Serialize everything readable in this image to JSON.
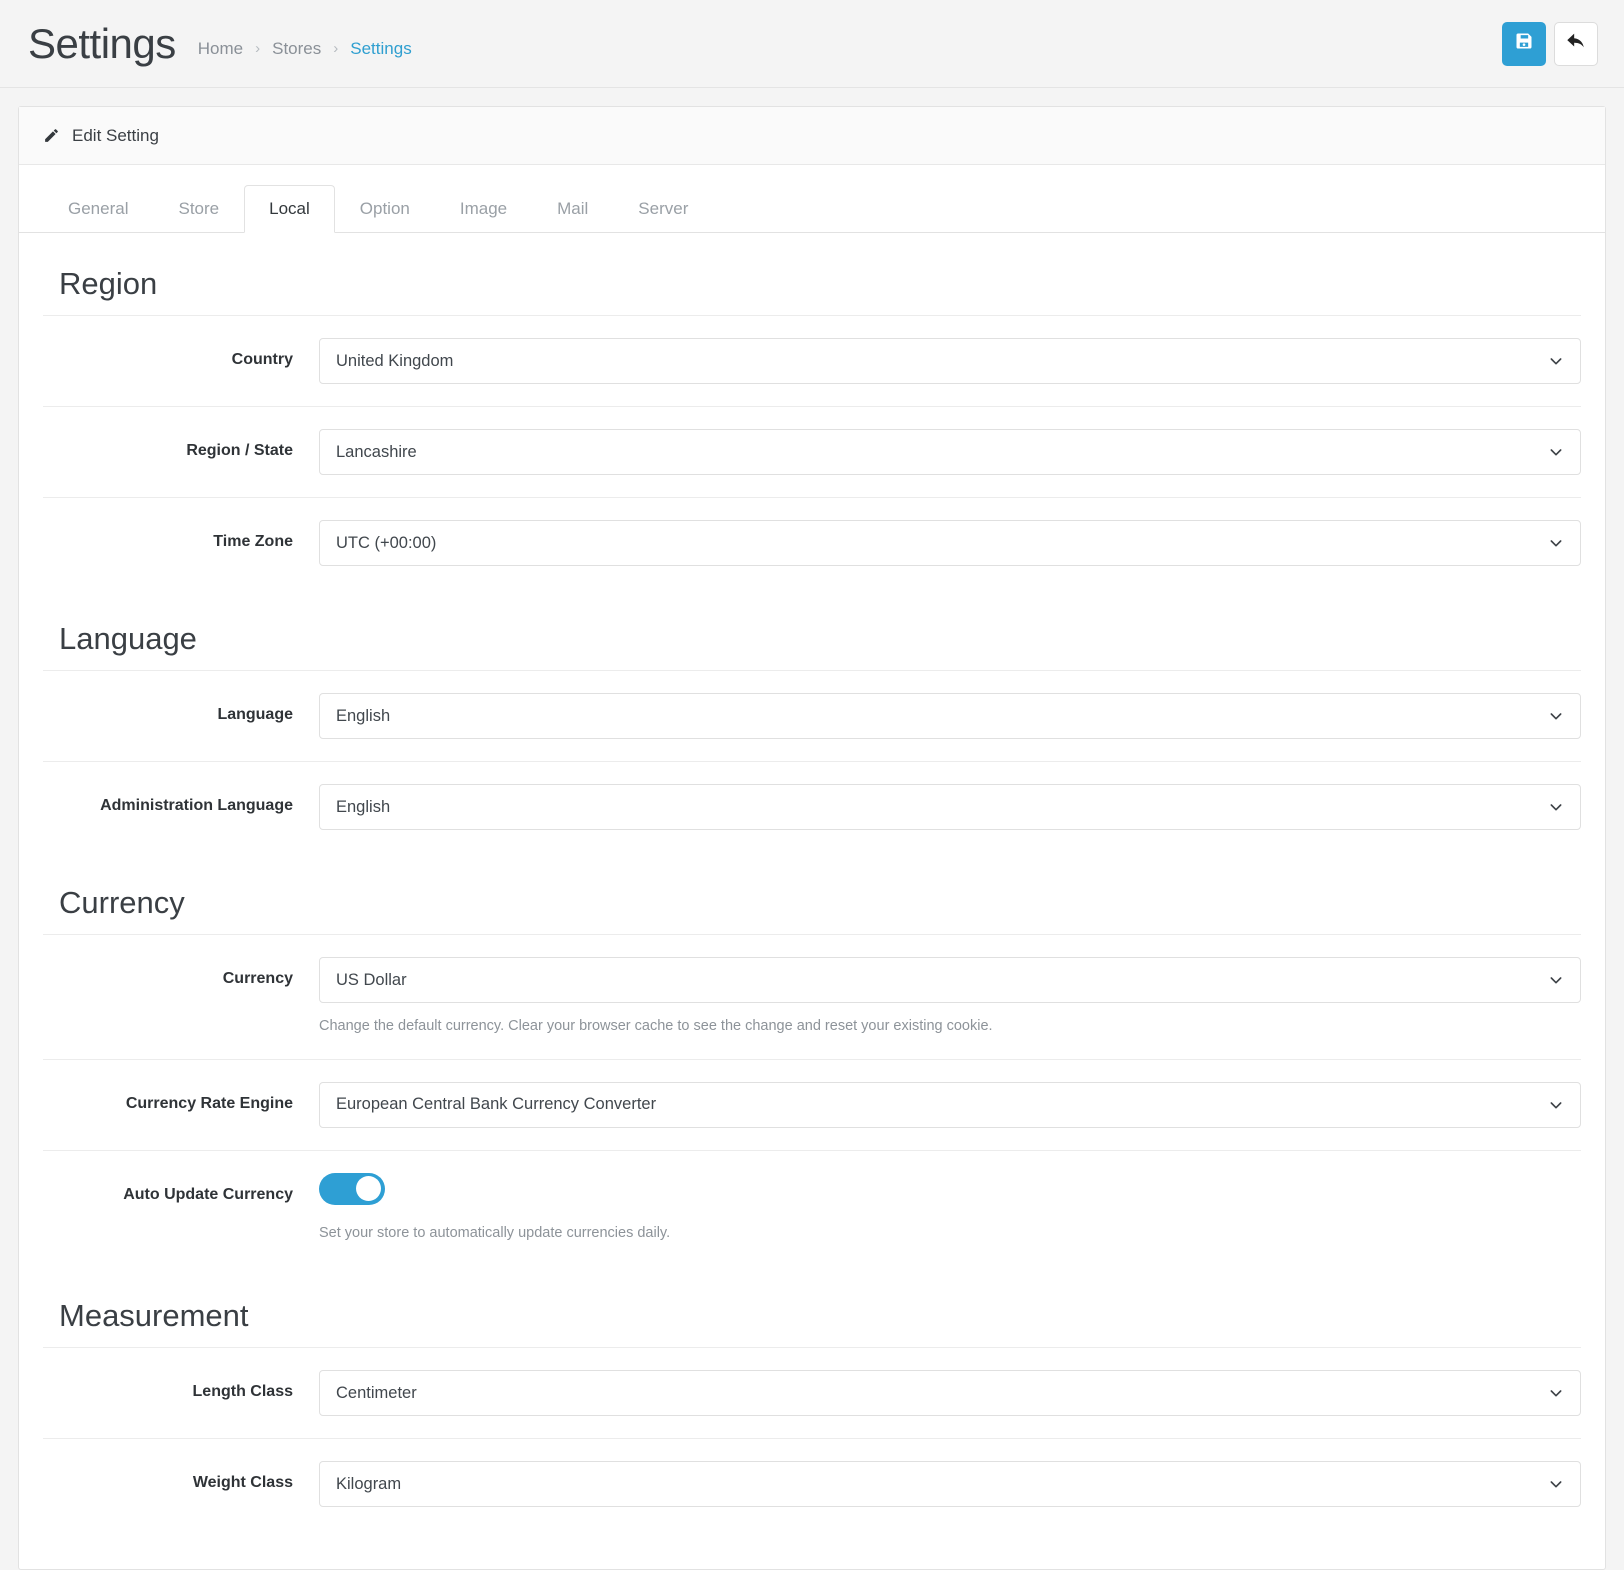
{
  "header": {
    "title": "Settings",
    "breadcrumb": [
      {
        "label": "Home",
        "active": false
      },
      {
        "label": "Stores",
        "active": false
      },
      {
        "label": "Settings",
        "active": true
      }
    ],
    "separator": "›",
    "actions": {
      "save": {
        "name": "save-icon",
        "title": "Save"
      },
      "back": {
        "name": "back-arrow-icon",
        "title": "Back"
      }
    },
    "accent_color": "#2e9fd4",
    "link_color": "#2f9fd0"
  },
  "card": {
    "header_icon": "pencil-icon",
    "header_title": "Edit Setting"
  },
  "tabs": [
    {
      "label": "General",
      "active": false
    },
    {
      "label": "Store",
      "active": false
    },
    {
      "label": "Local",
      "active": true
    },
    {
      "label": "Option",
      "active": false
    },
    {
      "label": "Image",
      "active": false
    },
    {
      "label": "Mail",
      "active": false
    },
    {
      "label": "Server",
      "active": false
    }
  ],
  "sections": [
    {
      "title": "Region",
      "rows": [
        {
          "label": "Country",
          "type": "select",
          "value": "United Kingdom",
          "help": ""
        },
        {
          "label": "Region / State",
          "type": "select",
          "value": "Lancashire",
          "help": ""
        },
        {
          "label": "Time Zone",
          "type": "select",
          "value": "UTC (+00:00)",
          "help": ""
        }
      ]
    },
    {
      "title": "Language",
      "rows": [
        {
          "label": "Language",
          "type": "select",
          "value": "English",
          "help": ""
        },
        {
          "label": "Administration Language",
          "type": "select",
          "value": "English",
          "help": ""
        }
      ]
    },
    {
      "title": "Currency",
      "rows": [
        {
          "label": "Currency",
          "type": "select",
          "value": "US Dollar",
          "help": "Change the default currency. Clear your browser cache to see the change and reset your existing cookie."
        },
        {
          "label": "Currency Rate Engine",
          "type": "select",
          "value": "European Central Bank Currency Converter",
          "help": ""
        },
        {
          "label": "Auto Update Currency",
          "type": "toggle",
          "value": "on",
          "help": "Set your store to automatically update currencies daily."
        }
      ]
    },
    {
      "title": "Measurement",
      "rows": [
        {
          "label": "Length Class",
          "type": "select",
          "value": "Centimeter",
          "help": ""
        },
        {
          "label": "Weight Class",
          "type": "select",
          "value": "Kilogram",
          "help": ""
        }
      ]
    }
  ]
}
